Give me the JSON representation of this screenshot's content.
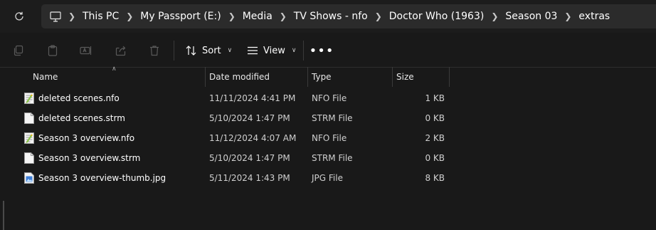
{
  "breadcrumb": [
    "This PC",
    "My Passport (E:)",
    "Media",
    "TV Shows - nfo",
    "Doctor Who (1963)",
    "Season 03",
    "extras"
  ],
  "toolbar": {
    "sort_label": "Sort",
    "view_label": "View",
    "more_label": "•••"
  },
  "columns": {
    "name": "Name",
    "date": "Date modified",
    "type": "Type",
    "size": "Size"
  },
  "files": [
    {
      "name": "deleted scenes.nfo",
      "date": "11/11/2024 4:41 PM",
      "type": "NFO File",
      "size": "1 KB",
      "icon": "nfo-file-icon"
    },
    {
      "name": "deleted scenes.strm",
      "date": "5/10/2024 1:47 PM",
      "type": "STRM File",
      "size": "0 KB",
      "icon": "blank-file-icon"
    },
    {
      "name": "Season 3 overview.nfo",
      "date": "11/12/2024 4:07 AM",
      "type": "NFO File",
      "size": "2 KB",
      "icon": "nfo-file-icon"
    },
    {
      "name": "Season 3 overview.strm",
      "date": "5/10/2024 1:47 PM",
      "type": "STRM File",
      "size": "0 KB",
      "icon": "blank-file-icon"
    },
    {
      "name": "Season 3 overview-thumb.jpg",
      "date": "5/11/2024 1:43 PM",
      "type": "JPG File",
      "size": "8 KB",
      "icon": "image-file-icon"
    }
  ],
  "colors": {
    "background": "#191919",
    "address_bar": "#2b2b2b",
    "nfo_icon_accent": "#8bc34a"
  }
}
